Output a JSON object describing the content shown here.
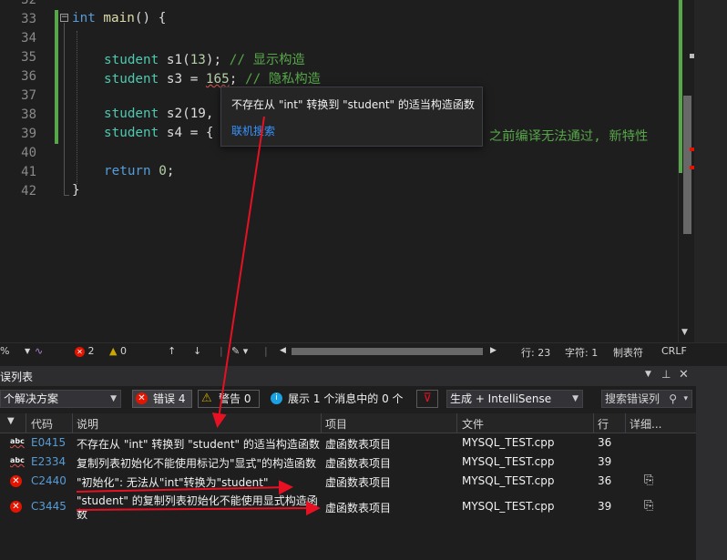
{
  "editor": {
    "lines": [
      {
        "num": "32"
      },
      {
        "num": "33"
      },
      {
        "num": "34"
      },
      {
        "num": "35"
      },
      {
        "num": "36"
      },
      {
        "num": "37"
      },
      {
        "num": "38"
      },
      {
        "num": "39"
      },
      {
        "num": "40"
      },
      {
        "num": "41"
      },
      {
        "num": "42"
      }
    ],
    "code": {
      "l33_kw": "int",
      "l33_fn": " main",
      "l33_rest": "() {",
      "l35_ty": "student",
      "l35_rest": " s1(",
      "l35_num": "13",
      "l35_end": "); ",
      "l35_cm": "// 显示构造",
      "l36_ty": "student",
      "l36_rest": " s3 = ",
      "l36_num": "165",
      "l36_end": "; ",
      "l36_cm": "// 隐私构造",
      "l38_ty": "student",
      "l38_rest": " s2(19,",
      "l39_ty": "student",
      "l39_rest": " s4 = {",
      "l39_cm": "11 之前编译无法通过, 新特性",
      "l41_kw": "return",
      "l41_num": " 0",
      "l41_end": ";",
      "l42": "}"
    },
    "tooltip": {
      "message": "不存在从 \"int\" 转换到 \"student\" 的适当构造函数",
      "link": "联机搜索"
    }
  },
  "status": {
    "zoom": "%",
    "errors": "2",
    "warnings": "0",
    "line": "行: 23",
    "char": "字符: 1",
    "tab": "制表符",
    "eol": "CRLF"
  },
  "panel": {
    "title": "误列表",
    "scope": "个解决方案",
    "errors_btn": "错误 4",
    "warnings_btn": "警告 0",
    "messages_btn": "展示 1 个消息中的 0 个",
    "build_combo": "生成 + IntelliSense",
    "search": "搜索错误列",
    "columns": {
      "code": "代码",
      "desc": "说明",
      "project": "项目",
      "file": "文件",
      "line": "行",
      "detail": "详细..."
    },
    "rows": [
      {
        "icon": "abc",
        "code": "E0415",
        "desc": "不存在从 \"int\" 转换到 \"student\" 的适当构造函数",
        "project": "虚函数表项目",
        "file": "MYSQL_TEST.cpp",
        "line": "36"
      },
      {
        "icon": "abc",
        "code": "E2334",
        "desc": "复制列表初始化不能使用标记为\"显式\"的构造函数",
        "project": "虚函数表项目",
        "file": "MYSQL_TEST.cpp",
        "line": "39"
      },
      {
        "icon": "err",
        "code": "C2440",
        "desc": "\"初始化\": 无法从\"int\"转换为\"student\"",
        "project": "虚函数表项目",
        "file": "MYSQL_TEST.cpp",
        "line": "36"
      },
      {
        "icon": "err",
        "code": "C3445",
        "desc": "\"student\" 的复制列表初始化不能使用显式构造函",
        "desc2": "数",
        "project": "虚函数表项目",
        "file": "MYSQL_TEST.cpp",
        "line": "39"
      }
    ]
  },
  "colors": {
    "annotation": "#e81123",
    "accent": "#007acc",
    "error": "#e51400"
  }
}
